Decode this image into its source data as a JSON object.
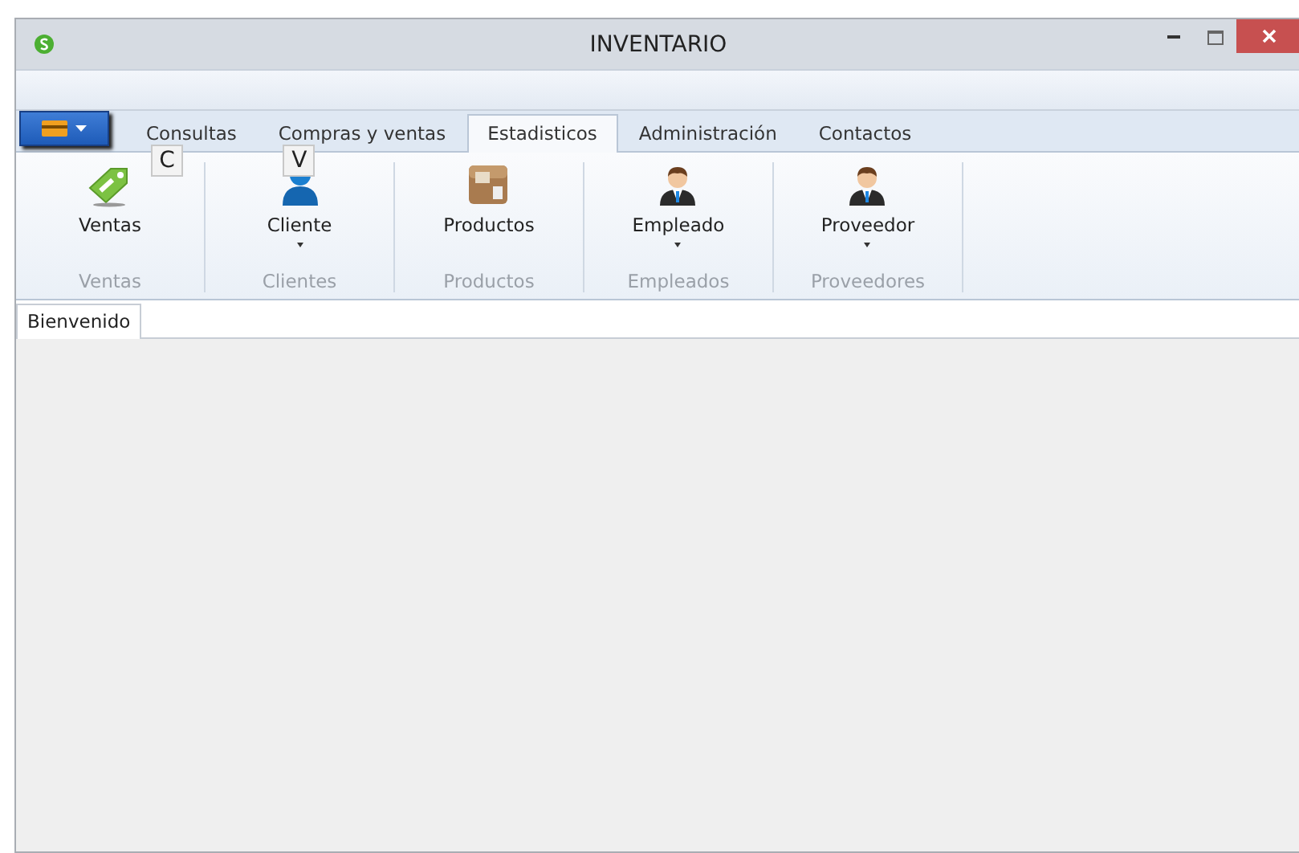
{
  "window": {
    "title": "INVENTARIO"
  },
  "tabs": [
    {
      "label": "Consultas",
      "selected": false,
      "key_tip": "C"
    },
    {
      "label": "Compras y ventas",
      "selected": false,
      "key_tip": "V"
    },
    {
      "label": "Estadisticos",
      "selected": true
    },
    {
      "label": "Administración",
      "selected": false
    },
    {
      "label": "Contactos",
      "selected": false
    }
  ],
  "ribbon_groups": [
    {
      "label": "Ventas",
      "button": {
        "label": "Ventas",
        "kind": "tag",
        "dropdown": false
      }
    },
    {
      "label": "Clientes",
      "button": {
        "label": "Cliente",
        "kind": "user",
        "dropdown": true
      }
    },
    {
      "label": "Productos",
      "button": {
        "label": "Productos",
        "kind": "box",
        "dropdown": false
      }
    },
    {
      "label": "Empleados",
      "button": {
        "label": "Empleado",
        "kind": "businessman",
        "dropdown": true
      }
    },
    {
      "label": "Proveedores",
      "button": {
        "label": "Proveedor",
        "kind": "businessman",
        "dropdown": true
      }
    }
  ],
  "document_tabs": [
    {
      "label": "Bienvenido",
      "selected": true
    }
  ]
}
